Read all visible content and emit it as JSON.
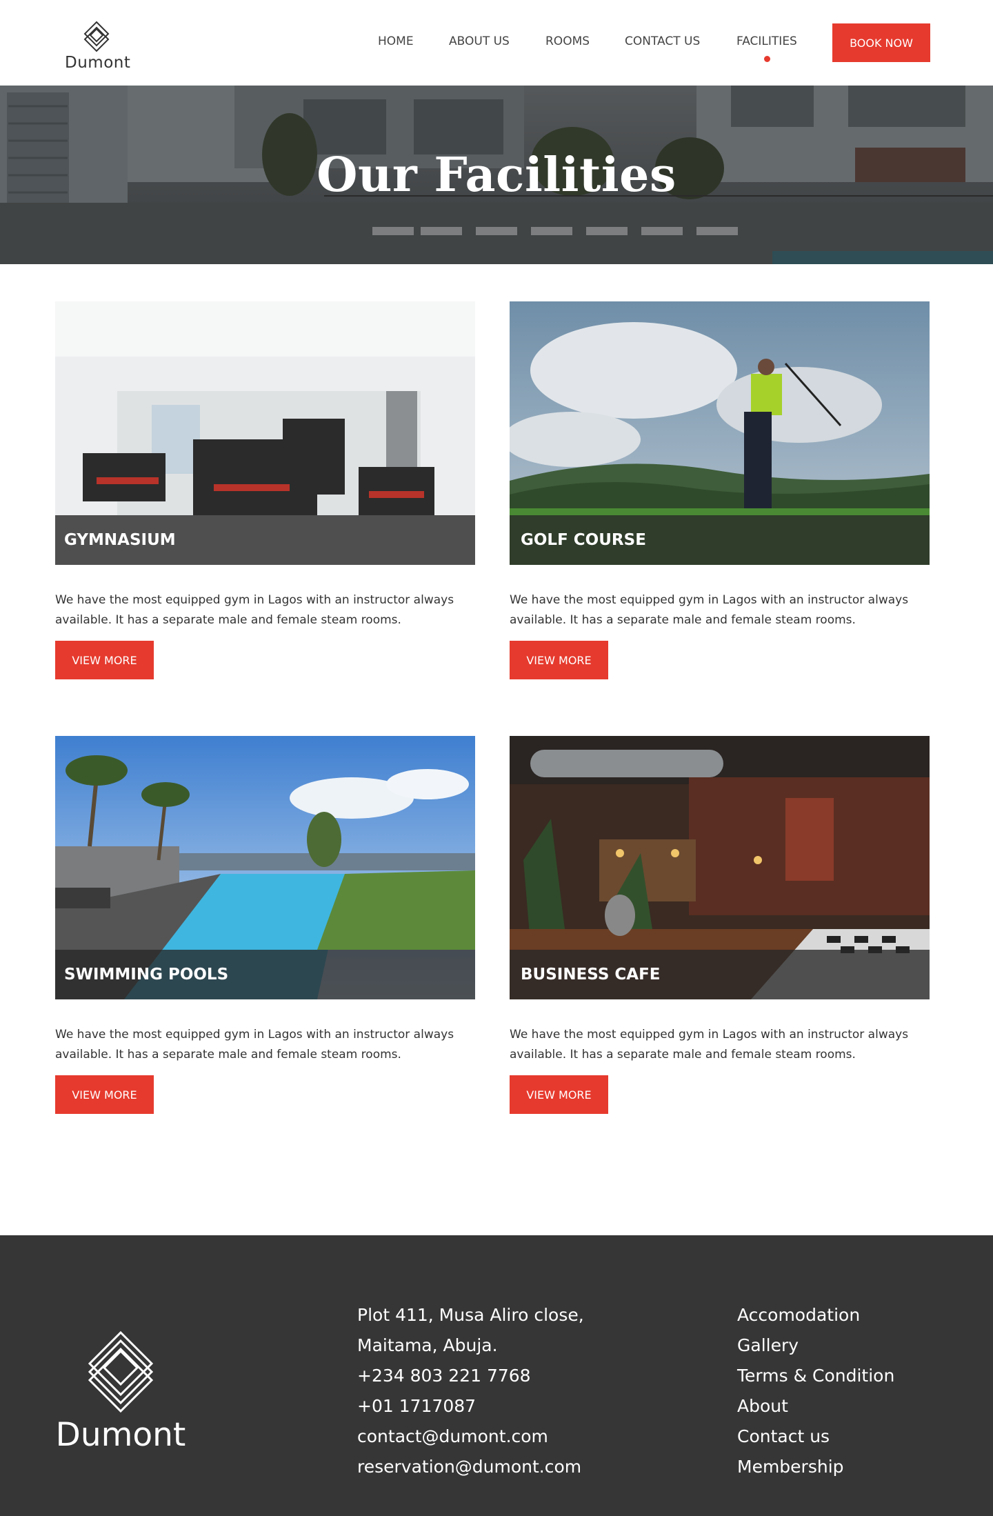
{
  "brand": {
    "name": "Dumont",
    "logo_icon": "stacked-diamond-icon"
  },
  "nav": {
    "items": [
      {
        "label": "HOME"
      },
      {
        "label": "ABOUT US"
      },
      {
        "label": "ROOMS"
      },
      {
        "label": "CONTACT US"
      },
      {
        "label": "FACILITIES",
        "active": true
      }
    ],
    "book_label": "BOOK NOW"
  },
  "hero": {
    "title": "Our Facilities"
  },
  "facilities": [
    {
      "title": "GYMNASIUM",
      "description": "We have the most equipped gym in Lagos with an instructor always available. It has a separate male and female steam rooms.",
      "button": "VIEW MORE"
    },
    {
      "title": "GOLF COURSE",
      "description": "We have the most equipped gym in Lagos with an instructor always available. It has a separate male and female steam rooms.",
      "button": "VIEW MORE"
    },
    {
      "title": "SWIMMING POOLS",
      "description": "We have the most equipped gym in Lagos with an instructor always available. It has a separate male and female steam rooms.",
      "button": "VIEW MORE"
    },
    {
      "title": "BUSINESS CAFE",
      "description": "We have the most equipped gym in Lagos with an instructor always available. It has a separate male and female steam rooms.",
      "button": "VIEW MORE"
    }
  ],
  "footer": {
    "brand": "Dumont",
    "contact": [
      "Plot 411, Musa Aliro close,",
      "Maitama, Abuja.",
      "+234 803 221 7768",
      "+01 1717087",
      "contact@dumont.com",
      "reservation@dumont.com"
    ],
    "links": [
      "Accomodation",
      "Gallery",
      "Terms & Condition",
      "About",
      "Contact us",
      "Membership"
    ]
  },
  "colors": {
    "accent": "#e63a2e",
    "footer_bg": "#363636",
    "text": "#333333"
  }
}
